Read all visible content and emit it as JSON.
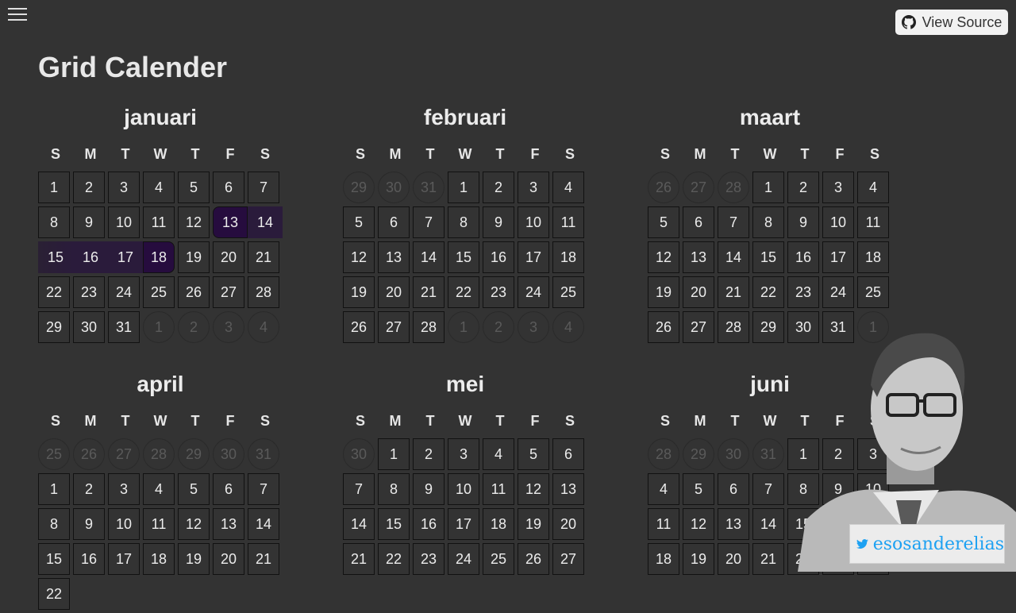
{
  "header": {
    "title": "Grid Calender",
    "view_source_label": "View Source"
  },
  "weekday_labels": [
    "S",
    "M",
    "T",
    "W",
    "T",
    "F",
    "S"
  ],
  "months": [
    {
      "name": "januari",
      "lead": [],
      "days": 31,
      "trail": [
        1,
        2,
        3,
        4
      ],
      "selection": [
        13,
        14,
        15,
        16,
        17,
        18
      ]
    },
    {
      "name": "februari",
      "lead": [
        29,
        30,
        31
      ],
      "days": 28,
      "trail": [
        1,
        2,
        3,
        4
      ],
      "selection": []
    },
    {
      "name": "maart",
      "lead": [
        26,
        27,
        28
      ],
      "days": 31,
      "trail": [
        1
      ],
      "selection": []
    },
    {
      "name": "april",
      "lead": [
        25,
        26,
        27,
        28,
        29,
        30,
        31
      ],
      "days": 22,
      "trail": [],
      "selection": []
    },
    {
      "name": "mei",
      "lead": [
        30
      ],
      "days": 27,
      "trail": [],
      "selection": []
    },
    {
      "name": "juni",
      "lead": [
        28,
        29,
        30,
        31
      ],
      "days": 24,
      "trail": [],
      "selection": []
    }
  ],
  "social": {
    "twitter_handle": "esosanderelias",
    "icon": "twitter-icon"
  },
  "colors": {
    "background": "#333333",
    "selection": "#2a1b3b",
    "twitter": "#1da1f2"
  }
}
